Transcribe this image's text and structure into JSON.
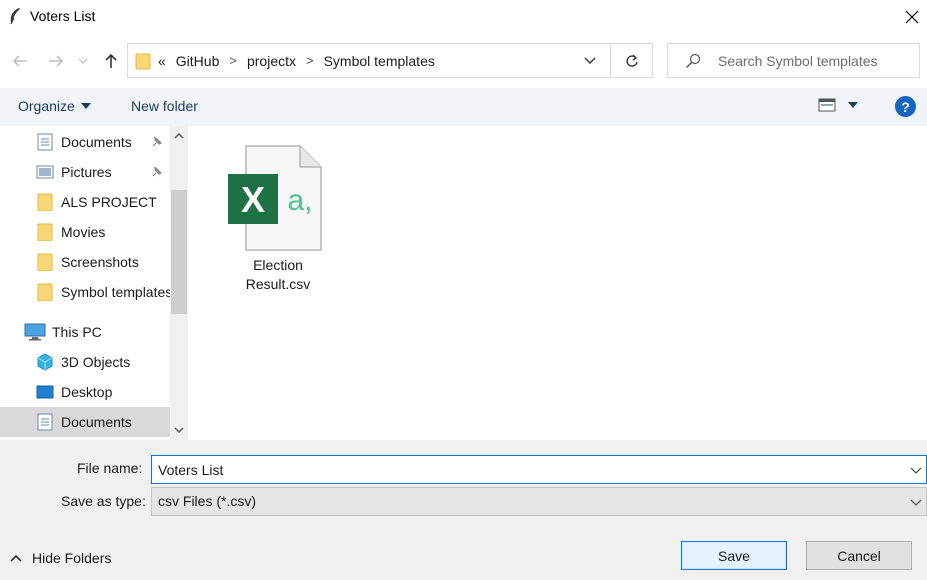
{
  "window": {
    "title": "Voters List"
  },
  "address": {
    "overflow": "«",
    "crumbs": [
      "GitHub",
      "projectx",
      "Symbol templates"
    ],
    "separator": ">"
  },
  "search": {
    "placeholder": "Search Symbol templates"
  },
  "toolbar": {
    "organize_label": "Organize",
    "new_folder_label": "New folder",
    "help_label": "?"
  },
  "sidebar": {
    "items": [
      {
        "label": "Documents",
        "icon": "documents-icon",
        "pinned": true
      },
      {
        "label": "Pictures",
        "icon": "pictures-icon",
        "pinned": true
      },
      {
        "label": "ALS PROJECT",
        "icon": "folder-icon"
      },
      {
        "label": "Movies",
        "icon": "folder-icon"
      },
      {
        "label": "Screenshots",
        "icon": "folder-icon"
      },
      {
        "label": "Symbol templates",
        "icon": "folder-icon"
      },
      {
        "label": "This PC",
        "icon": "computer-icon"
      },
      {
        "label": "3D Objects",
        "icon": "3d-objects-icon"
      },
      {
        "label": "Desktop",
        "icon": "desktop-icon"
      },
      {
        "label": "Documents",
        "icon": "documents-icon",
        "selected": true
      }
    ]
  },
  "files": [
    {
      "name": "Election Result.csv",
      "icon": "excel-csv-icon",
      "glyph": "X",
      "glyph2": "a,"
    }
  ],
  "form": {
    "file_name_label": "File name:",
    "file_name_value": "Voters List",
    "save_type_label": "Save as type:",
    "save_type_value": "csv Files (*.csv)"
  },
  "footer": {
    "hide_folders_label": "Hide Folders",
    "save_label": "Save",
    "cancel_label": "Cancel"
  },
  "colors": {
    "accent": "#0078d7",
    "help": "#1565c0",
    "excel_green": "#1e7145",
    "excel_text": "#4fc28d",
    "folder": "#f8d775"
  }
}
